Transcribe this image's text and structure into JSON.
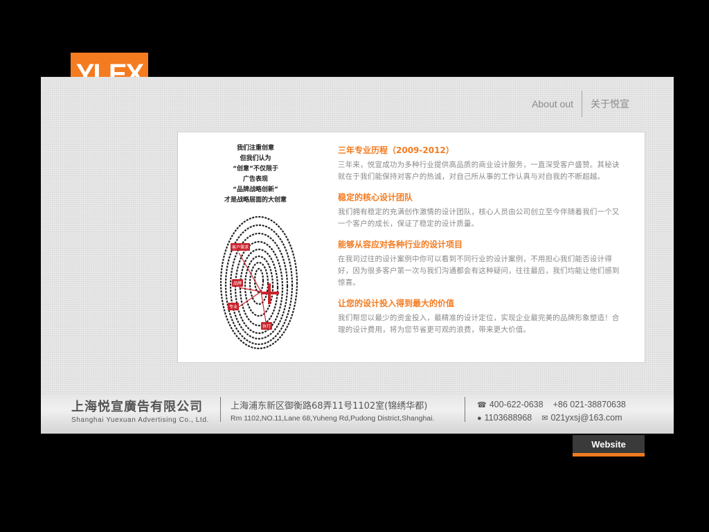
{
  "logo": {
    "text": "YLEX",
    "color": "#f47b20"
  },
  "nav": {
    "about_en": "About out",
    "about_cn": "关于悦宣"
  },
  "slogan": [
    "我们注重创意",
    "但我们认为",
    "“创意”不仅限于",
    "广告表现",
    "“品牌战略创新”",
    "才是战略层面的大创意"
  ],
  "fingerprint_tags": [
    "客户需求",
    "品牌",
    "专业",
    "执行"
  ],
  "sections": [
    {
      "title": "三年专业历程（2009-2012）",
      "body": "三年来，悦宣成功为多种行业提供高品质的商业设计服务，一直深受客户盛赞。其秘诀就在于我们能保持对客户的热诚，对自己所从事的工作认真与对自我的不断超越。"
    },
    {
      "title": "稳定的核心设计团队",
      "body": "我们拥有稳定的充满创作激情的设计团队，核心人员由公司创立至今伴随着我们一个又一个客户的成长，保证了稳定的设计质量。"
    },
    {
      "title": "能够从容应对各种行业的设计项目",
      "body": "在我司过往的设计案例中你可以看到不同行业的设计案例，不用担心我们能否设计得好，因为很多客户第一次与我们沟通都会有这种疑问，往往最后，我们均能让他们感到惊喜。"
    },
    {
      "title": "让您的设计投入得到最大的价值",
      "body": "我们帮您以最少的资金投入，最精准的设计定位，实现企业最完美的品牌形象塑造！合理的设计费用，将为您节省更可观的浪费，带来更大价值。"
    }
  ],
  "footer": {
    "company_cn": "上海悦宣廣告有限公司",
    "company_en": "Shanghai Yuexuan Advertising Co., Ltd.",
    "address_cn": "上海浦东新区御衡路68弄11号1102室(锦绣华都)",
    "address_en": "Rm 1102,NO.11,Lane 68,Yuheng Rd,Pudong District,Shanghai.",
    "phone": "400-622-0638",
    "phone2": "+86 021-38870638",
    "qq": "1103688968",
    "email": "021yxsj@163.com"
  },
  "website_button": "Website"
}
